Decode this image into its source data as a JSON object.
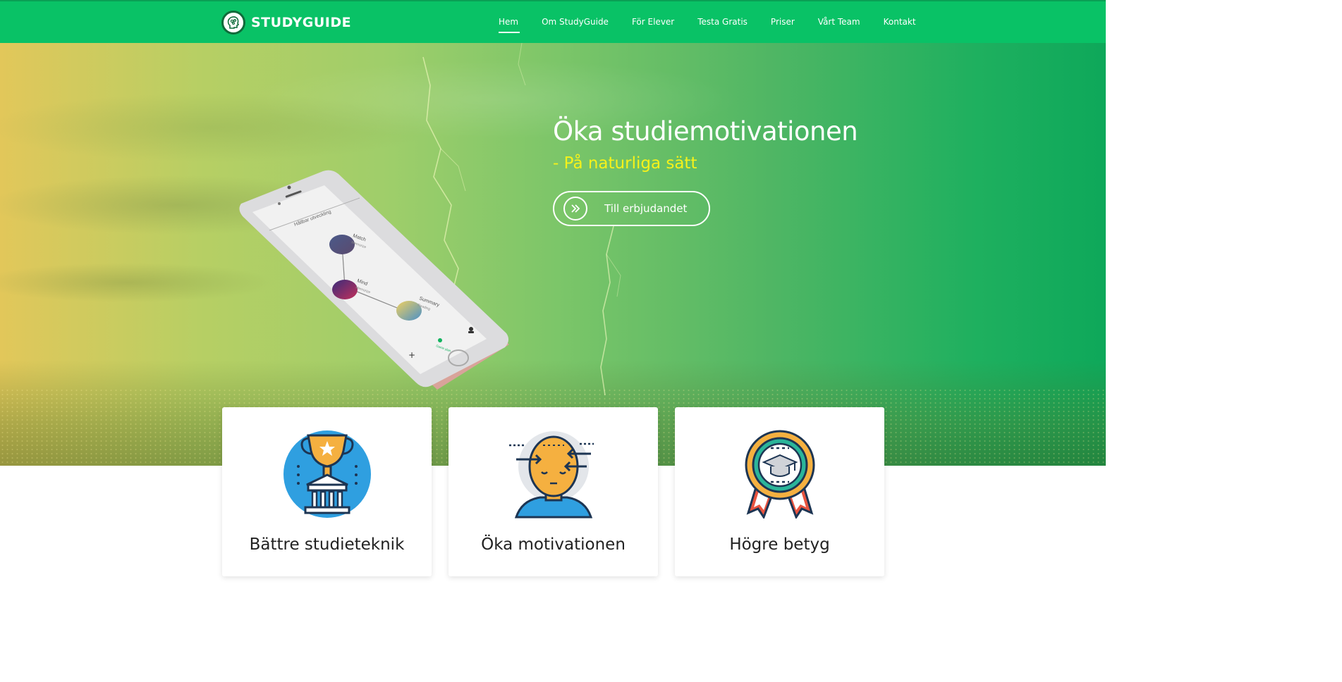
{
  "brand": {
    "name": "STUDYGUIDE"
  },
  "nav": {
    "items": [
      {
        "label": "Hem",
        "active": true
      },
      {
        "label": "Om StudyGuide",
        "active": false
      },
      {
        "label": "För Elever",
        "active": false
      },
      {
        "label": "Testa Gratis",
        "active": false
      },
      {
        "label": "Priser",
        "active": false
      },
      {
        "label": "Vårt Team",
        "active": false
      },
      {
        "label": "Kontakt",
        "active": false
      }
    ]
  },
  "hero": {
    "title": "Öka studiemotivationen",
    "subtitle": "- På naturliga sätt",
    "cta_label": "Till erbjudandet"
  },
  "phone": {
    "screen_title": "Hållbar utveckling",
    "nodes": [
      {
        "title": "Match",
        "sub": "Memorize"
      },
      {
        "title": "Mind",
        "sub": "Memorize"
      },
      {
        "title": "Summary",
        "sub": "Reading"
      }
    ],
    "tab_label": "Game plan"
  },
  "cards": [
    {
      "title": "Bättre studieteknik",
      "icon": "trophy-icon"
    },
    {
      "title": "Öka motivationen",
      "icon": "head-focus-icon"
    },
    {
      "title": "Högre betyg",
      "icon": "graduation-badge-icon"
    }
  ],
  "colors": {
    "nav_green": "#09c266",
    "subtitle_yellow": "#f6f21a",
    "hero_left": "#e2c75a",
    "hero_right": "#0ea85a"
  }
}
